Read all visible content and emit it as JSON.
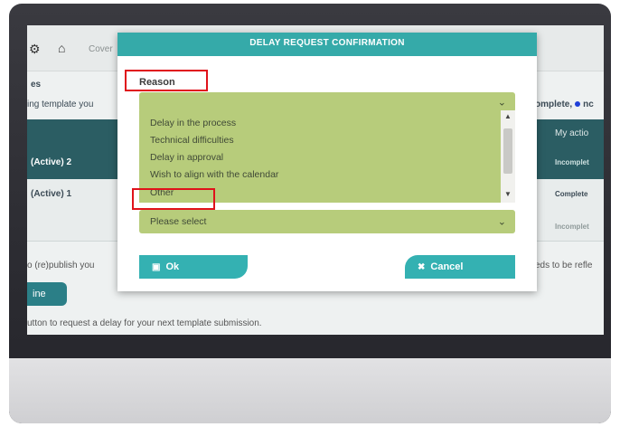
{
  "background": {
    "breadcrumb_text": "Cover",
    "section_title": "es",
    "template_text": "ing template you",
    "legend_complete": "omplete,",
    "legend_no": "nc",
    "column_my_actions": "My actio",
    "rows": [
      {
        "label": "(Active) 2",
        "status": "Incomplet"
      },
      {
        "label": "(Active) 1",
        "status": "Complete"
      },
      {
        "label": "",
        "status": "Incomplet"
      }
    ],
    "republish_text": "o (re)publish you",
    "needs_reflect_text": "eds to be refle",
    "left_button_label": "ine",
    "footer_text": "utton to request a delay for your next template submission."
  },
  "modal": {
    "title": "DELAY REQUEST CONFIRMATION",
    "reason_label": "Reason",
    "reason_options": [
      "Delay in the process",
      "Technical difficulties",
      "Delay in approval",
      "Wish to align with the calendar",
      "Other"
    ],
    "second_select_value": "Please select",
    "ok_label": "Ok",
    "cancel_label": "Cancel"
  },
  "colors": {
    "header_teal": "#35aaa9",
    "select_green": "#b7cc7b",
    "highlight_red": "#e0121b",
    "table_band": "#2b5d63"
  }
}
